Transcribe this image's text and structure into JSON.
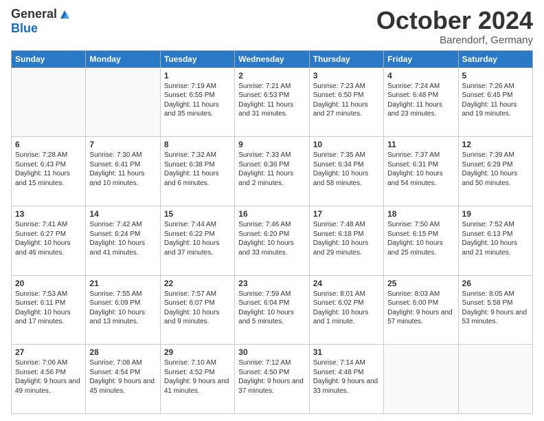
{
  "header": {
    "logo_general": "General",
    "logo_blue": "Blue",
    "month_title": "October 2024",
    "location": "Barendorf, Germany"
  },
  "days_of_week": [
    "Sunday",
    "Monday",
    "Tuesday",
    "Wednesday",
    "Thursday",
    "Friday",
    "Saturday"
  ],
  "weeks": [
    [
      {
        "day": "",
        "info": ""
      },
      {
        "day": "",
        "info": ""
      },
      {
        "day": "1",
        "info": "Sunrise: 7:19 AM\nSunset: 6:55 PM\nDaylight: 11 hours and 35 minutes."
      },
      {
        "day": "2",
        "info": "Sunrise: 7:21 AM\nSunset: 6:53 PM\nDaylight: 11 hours and 31 minutes."
      },
      {
        "day": "3",
        "info": "Sunrise: 7:23 AM\nSunset: 6:50 PM\nDaylight: 11 hours and 27 minutes."
      },
      {
        "day": "4",
        "info": "Sunrise: 7:24 AM\nSunset: 6:48 PM\nDaylight: 11 hours and 23 minutes."
      },
      {
        "day": "5",
        "info": "Sunrise: 7:26 AM\nSunset: 6:45 PM\nDaylight: 11 hours and 19 minutes."
      }
    ],
    [
      {
        "day": "6",
        "info": "Sunrise: 7:28 AM\nSunset: 6:43 PM\nDaylight: 11 hours and 15 minutes."
      },
      {
        "day": "7",
        "info": "Sunrise: 7:30 AM\nSunset: 6:41 PM\nDaylight: 11 hours and 10 minutes."
      },
      {
        "day": "8",
        "info": "Sunrise: 7:32 AM\nSunset: 6:38 PM\nDaylight: 11 hours and 6 minutes."
      },
      {
        "day": "9",
        "info": "Sunrise: 7:33 AM\nSunset: 6:36 PM\nDaylight: 11 hours and 2 minutes."
      },
      {
        "day": "10",
        "info": "Sunrise: 7:35 AM\nSunset: 6:34 PM\nDaylight: 10 hours and 58 minutes."
      },
      {
        "day": "11",
        "info": "Sunrise: 7:37 AM\nSunset: 6:31 PM\nDaylight: 10 hours and 54 minutes."
      },
      {
        "day": "12",
        "info": "Sunrise: 7:39 AM\nSunset: 6:29 PM\nDaylight: 10 hours and 50 minutes."
      }
    ],
    [
      {
        "day": "13",
        "info": "Sunrise: 7:41 AM\nSunset: 6:27 PM\nDaylight: 10 hours and 46 minutes."
      },
      {
        "day": "14",
        "info": "Sunrise: 7:42 AM\nSunset: 6:24 PM\nDaylight: 10 hours and 41 minutes."
      },
      {
        "day": "15",
        "info": "Sunrise: 7:44 AM\nSunset: 6:22 PM\nDaylight: 10 hours and 37 minutes."
      },
      {
        "day": "16",
        "info": "Sunrise: 7:46 AM\nSunset: 6:20 PM\nDaylight: 10 hours and 33 minutes."
      },
      {
        "day": "17",
        "info": "Sunrise: 7:48 AM\nSunset: 6:18 PM\nDaylight: 10 hours and 29 minutes."
      },
      {
        "day": "18",
        "info": "Sunrise: 7:50 AM\nSunset: 6:15 PM\nDaylight: 10 hours and 25 minutes."
      },
      {
        "day": "19",
        "info": "Sunrise: 7:52 AM\nSunset: 6:13 PM\nDaylight: 10 hours and 21 minutes."
      }
    ],
    [
      {
        "day": "20",
        "info": "Sunrise: 7:53 AM\nSunset: 6:11 PM\nDaylight: 10 hours and 17 minutes."
      },
      {
        "day": "21",
        "info": "Sunrise: 7:55 AM\nSunset: 6:09 PM\nDaylight: 10 hours and 13 minutes."
      },
      {
        "day": "22",
        "info": "Sunrise: 7:57 AM\nSunset: 6:07 PM\nDaylight: 10 hours and 9 minutes."
      },
      {
        "day": "23",
        "info": "Sunrise: 7:59 AM\nSunset: 6:04 PM\nDaylight: 10 hours and 5 minutes."
      },
      {
        "day": "24",
        "info": "Sunrise: 8:01 AM\nSunset: 6:02 PM\nDaylight: 10 hours and 1 minute."
      },
      {
        "day": "25",
        "info": "Sunrise: 8:03 AM\nSunset: 6:00 PM\nDaylight: 9 hours and 57 minutes."
      },
      {
        "day": "26",
        "info": "Sunrise: 8:05 AM\nSunset: 5:58 PM\nDaylight: 9 hours and 53 minutes."
      }
    ],
    [
      {
        "day": "27",
        "info": "Sunrise: 7:06 AM\nSunset: 4:56 PM\nDaylight: 9 hours and 49 minutes."
      },
      {
        "day": "28",
        "info": "Sunrise: 7:08 AM\nSunset: 4:54 PM\nDaylight: 9 hours and 45 minutes."
      },
      {
        "day": "29",
        "info": "Sunrise: 7:10 AM\nSunset: 4:52 PM\nDaylight: 9 hours and 41 minutes."
      },
      {
        "day": "30",
        "info": "Sunrise: 7:12 AM\nSunset: 4:50 PM\nDaylight: 9 hours and 37 minutes."
      },
      {
        "day": "31",
        "info": "Sunrise: 7:14 AM\nSunset: 4:48 PM\nDaylight: 9 hours and 33 minutes."
      },
      {
        "day": "",
        "info": ""
      },
      {
        "day": "",
        "info": ""
      }
    ]
  ]
}
